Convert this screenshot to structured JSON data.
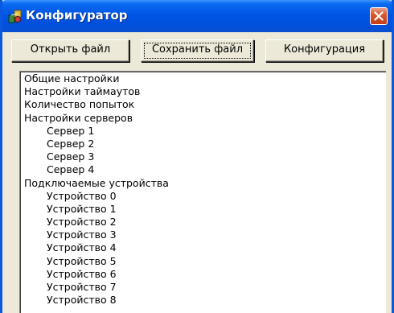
{
  "window": {
    "title": "Конфигуратор"
  },
  "toolbar": {
    "open_label": "Открыть файл",
    "save_label": "Сохранить файл",
    "config_label": "Конфигурация"
  },
  "tree": {
    "items": [
      {
        "label": "Общие настройки",
        "level": 0
      },
      {
        "label": "Настройки таймаутов",
        "level": 0
      },
      {
        "label": "Количество попыток",
        "level": 0
      },
      {
        "label": "Настройки серверов",
        "level": 0
      },
      {
        "label": "Сервер 1",
        "level": 1
      },
      {
        "label": "Сервер 2",
        "level": 1
      },
      {
        "label": "Сервер 3",
        "level": 1
      },
      {
        "label": "Сервер 4",
        "level": 1
      },
      {
        "label": "Подключаемые устройства",
        "level": 0
      },
      {
        "label": "Устройство 0",
        "level": 1
      },
      {
        "label": "Устройство 1",
        "level": 1
      },
      {
        "label": "Устройство 2",
        "level": 1
      },
      {
        "label": "Устройство 3",
        "level": 1
      },
      {
        "label": "Устройство 4",
        "level": 1
      },
      {
        "label": "Устройство 5",
        "level": 1
      },
      {
        "label": "Устройство 6",
        "level": 1
      },
      {
        "label": "Устройство 7",
        "level": 1
      },
      {
        "label": "Устройство 8",
        "level": 1
      }
    ]
  },
  "icons": {
    "app": "configurator-app-icon",
    "close": "close-icon"
  },
  "colors": {
    "titlebar": "#0055e5",
    "window_bg": "#ece9d8",
    "close_button": "#d9582f"
  }
}
